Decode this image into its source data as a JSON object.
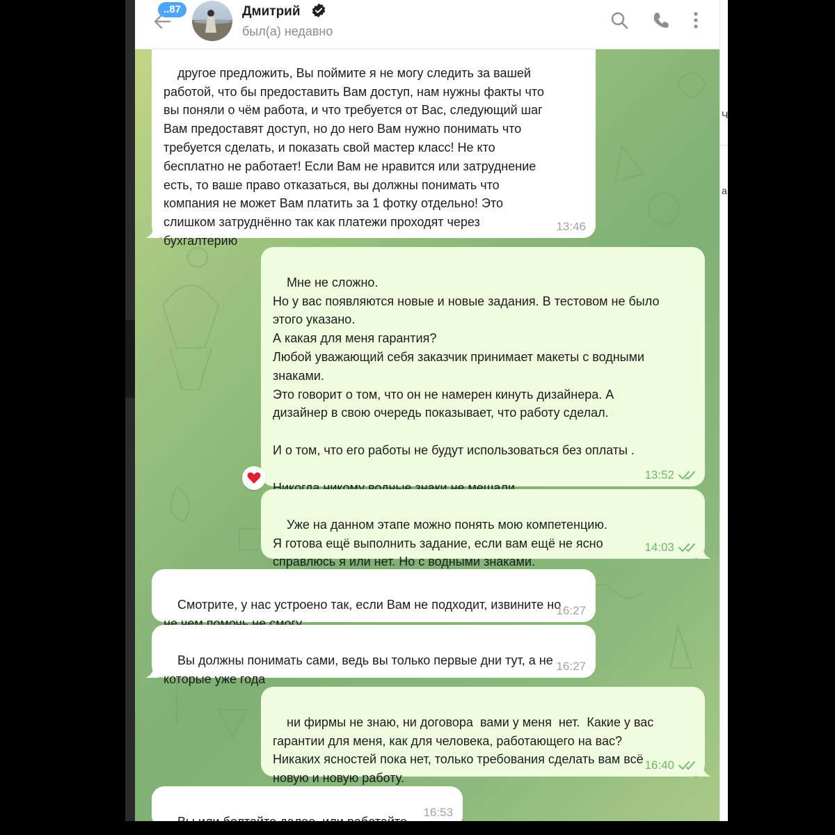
{
  "header": {
    "unread_count": "..87",
    "contact_name": "Дмитрий",
    "contact_status": "был(а) недавно"
  },
  "messages": [
    {
      "direction": "in",
      "text": "другое предложить, Вы поймите я не могу следить за вашей\nработой, что бы предоставить Вам доступ, нам нужны факты что\nвы поняли о чём работа, и что требуется от Вас, следующий шаг\nВам предоставят доступ, но до него Вам нужно понимать что\nтребуется сделать, и показать свой мастер класс! Не кто\nбесплатно не работает! Если Вам не нравится или затруднение\nесть, то ваше право отказаться, вы должны понимать что\nкомпания не может Вам платить за 1 фотку отдельно! Это\nслишком затруднённо так как платежи проходят через\nбухгалтерию",
      "time": "13:46"
    },
    {
      "direction": "out",
      "text": "Мне не сложно.\nНо у вас появляются новые и новые задания. В тестовом не было\nэтого указано.\nА какая для меня гарантия?\nЛюбой уважающий себя заказчик принимает макеты с водными\nзнаками.\nЭто говорит о том, что он не намерен кинуть дизайнера. А\nдизайнер в свою очередь показывает, что работу сделал.\n\nИ о том, что его работы не будут использоваться без оплаты .\n\nНикогда никому водные знаки не мешали.",
      "time": "13:52",
      "reaction": "heart"
    },
    {
      "direction": "out",
      "text": "Уже на данном этапе можно понять мою компетенцию.\nЯ готова ещё выполнить задание, если вам ещё не ясно\nсправлюсь я или нет. Но с водными знаками.",
      "time": "14:03"
    },
    {
      "direction": "in",
      "text": "Смотрите, у нас устроено так, если Вам не подходит, извините но\nне чем помочь не смогу",
      "time": "16:27"
    },
    {
      "direction": "in",
      "text": "Вы должны понимать сами, ведь вы только первые дни тут, а не\nкоторые уже года",
      "time": "16:27"
    },
    {
      "direction": "out",
      "text": "ни фирмы не знаю, ни договора  вами у меня  нет.  Какие у вас\nгарантии для меня, как для человека, работающего на вас?\nНикаких ясностей пока нет, только требования сделать вам всё\nновую и новую работу.",
      "time": "16:40"
    },
    {
      "direction": "in",
      "text": "Вы или болтайте далее, или работайте",
      "time": "16:53"
    }
  ],
  "colors": {
    "incoming_bubble": "#ffffff",
    "outgoing_bubble": "#effdde",
    "outgoing_time": "#6db56f",
    "badge": "#4ea4f6",
    "verified": "#1f1f1f",
    "reaction": "#e0202e"
  }
}
